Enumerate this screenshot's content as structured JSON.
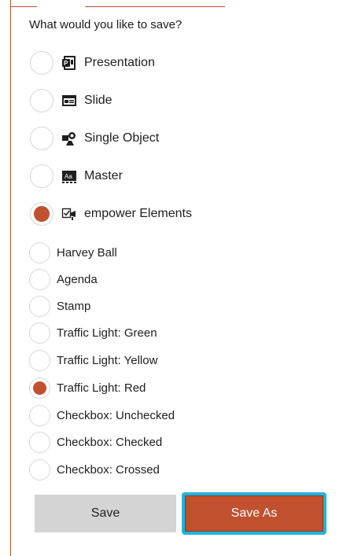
{
  "dialog": {
    "heading": "What would you like to save?"
  },
  "accent_color": "#c0502e",
  "focus_color": "#1fb4de",
  "main_options": [
    {
      "label": "Presentation",
      "icon": "presentation-icon",
      "checked": false
    },
    {
      "label": "Slide",
      "icon": "slide-icon",
      "checked": false
    },
    {
      "label": "Single Object",
      "icon": "shapes-icon",
      "checked": false
    },
    {
      "label": "Master",
      "icon": "master-icon",
      "checked": false
    },
    {
      "label": "empower Elements",
      "icon": "empower-elements-icon",
      "checked": true
    }
  ],
  "element_options": [
    {
      "label": "Harvey Ball",
      "checked": false
    },
    {
      "label": "Agenda",
      "checked": false
    },
    {
      "label": "Stamp",
      "checked": false
    },
    {
      "label": "Traffic Light: Green",
      "checked": false
    },
    {
      "label": "Traffic Light: Yellow",
      "checked": false
    },
    {
      "label": "Traffic Light: Red",
      "checked": true
    },
    {
      "label": "Checkbox: Unchecked",
      "checked": false
    },
    {
      "label": "Checkbox: Checked",
      "checked": false
    },
    {
      "label": "Checkbox: Crossed",
      "checked": false
    }
  ],
  "buttons": {
    "save_label": "Save",
    "save_as_label": "Save As"
  }
}
